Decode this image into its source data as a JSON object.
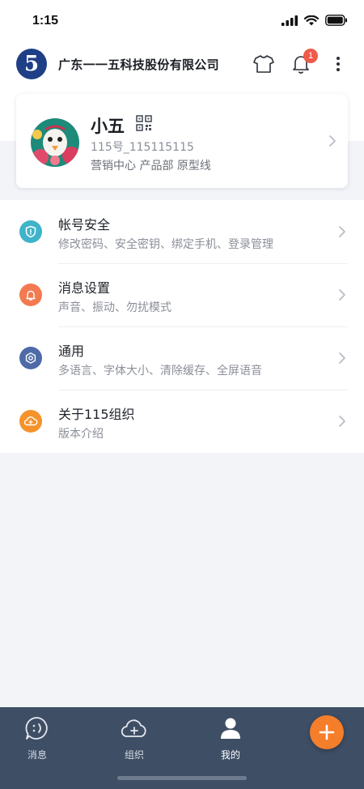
{
  "status": {
    "time": "1:15"
  },
  "header": {
    "org_logo_text": "5",
    "org_name": "广东一一五科技股份有限公司",
    "notification_count": "1"
  },
  "profile": {
    "name": "小五",
    "id_text": "115号_115115115",
    "department": "营销中心 产品部 原型线"
  },
  "settings": {
    "items": [
      {
        "title": "帐号安全",
        "subtitle": "修改密码、安全密钥、绑定手机、登录管理",
        "icon": "shield-icon",
        "color": "#3fb3c9"
      },
      {
        "title": "消息设置",
        "subtitle": "声音、振动、勿扰模式",
        "icon": "bell-icon",
        "color": "#f27a50"
      },
      {
        "title": "通用",
        "subtitle": "多语言、字体大小、清除缓存、全屏语音",
        "icon": "gear-icon",
        "color": "#4e6aa8"
      },
      {
        "title": "关于115组织",
        "subtitle": "版本介绍",
        "icon": "cloud-icon",
        "color": "#f5922b"
      }
    ]
  },
  "tabs": [
    {
      "label": "消息",
      "icon": "message-icon"
    },
    {
      "label": "组织",
      "icon": "organization-icon"
    },
    {
      "label": "我的",
      "icon": "profile-icon"
    }
  ],
  "colors": {
    "tab_bar": "#3e4e65",
    "fab": "#f57e2b",
    "badge": "#f05a4a",
    "logo": "#1f3f86"
  }
}
